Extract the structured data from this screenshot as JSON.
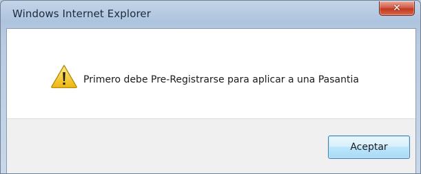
{
  "window": {
    "title": "Windows Internet Explorer",
    "close_glyph": "✕"
  },
  "dialog": {
    "icon": "warning-icon",
    "message": "Primero debe Pre-Registrarse para aplicar a una Pasantia",
    "ok_label": "Aceptar"
  },
  "colors": {
    "title_bar": "#b8cbe1",
    "close_button": "#c8412a",
    "warning_icon": "#f1c21b",
    "button_area": "#f0f0f0",
    "ok_button_border": "#3c7fb1"
  }
}
